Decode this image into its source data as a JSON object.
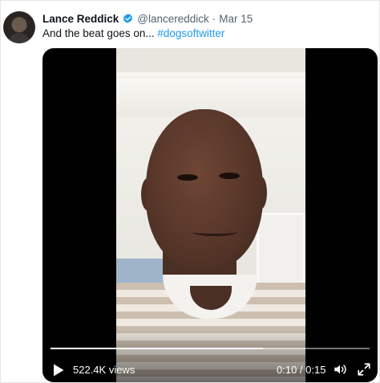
{
  "tweet": {
    "author": {
      "display_name": "Lance Reddick",
      "handle": "@lancereddick",
      "verified": true
    },
    "separator": "·",
    "date": "Mar 15",
    "text": "And the beat goes on... ",
    "hashtag": "#dogsoftwitter"
  },
  "video": {
    "views": "522.4K views",
    "time": "0:10 / 0:15",
    "progress": 0.667
  },
  "icons": {
    "verified": "verified-badge-icon",
    "play": "play-icon",
    "volume": "volume-icon",
    "fullscreen": "fullscreen-icon"
  },
  "colors": {
    "accent": "#1d9bf0",
    "text": "#0f1419",
    "secondary": "#536471"
  }
}
